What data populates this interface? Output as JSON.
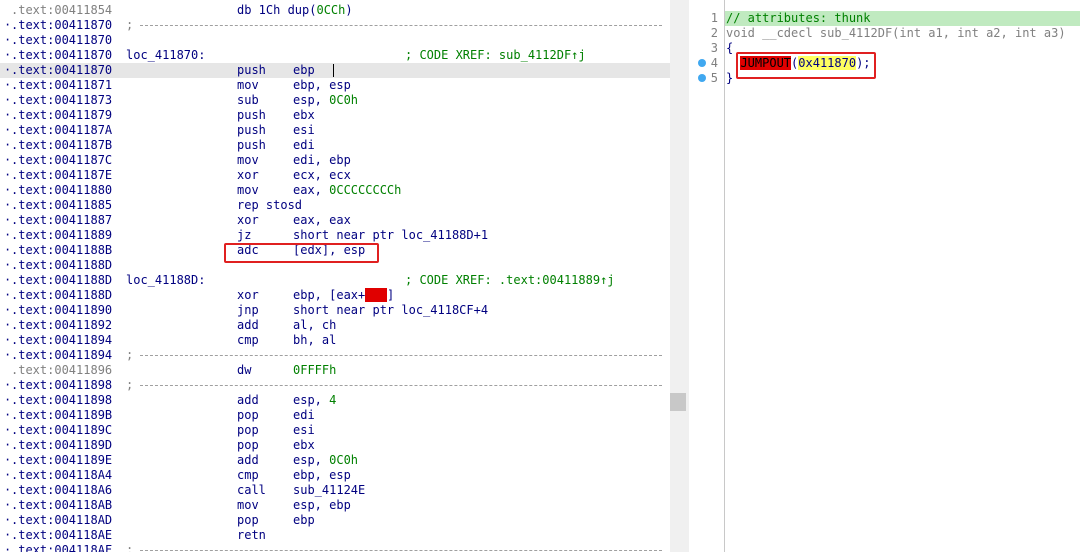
{
  "asm": {
    "rows": [
      {
        "addr": ".text:00411854",
        "mnem": "db 1Ch dup(",
        "num": "0CCh",
        "tail": ")"
      },
      {
        "addr": ".text:00411870",
        "sep": ";"
      },
      {
        "addr": ".text:00411870"
      },
      {
        "addr": ".text:00411870",
        "label": "loc_411870:",
        "xref": "; CODE XREF: sub_4112DF↑j"
      },
      {
        "addr": ".text:00411870",
        "mnem": "push",
        "ops": "ebp"
      },
      {
        "addr": ".text:00411871",
        "mnem": "mov",
        "ops": "ebp, esp"
      },
      {
        "addr": ".text:00411873",
        "mnem": "sub",
        "ops_pre": "esp, ",
        "ops_num": "0C0h"
      },
      {
        "addr": ".text:00411879",
        "mnem": "push",
        "ops": "ebx"
      },
      {
        "addr": ".text:0041187A",
        "mnem": "push",
        "ops": "esi"
      },
      {
        "addr": ".text:0041187B",
        "mnem": "push",
        "ops": "edi"
      },
      {
        "addr": ".text:0041187C",
        "mnem": "mov",
        "ops": "edi, ebp"
      },
      {
        "addr": ".text:0041187E",
        "mnem": "xor",
        "ops": "ecx, ecx"
      },
      {
        "addr": ".text:00411880",
        "mnem": "mov",
        "ops_pre": "eax, ",
        "ops_num": "0CCCCCCCCh"
      },
      {
        "addr": ".text:00411885",
        "mnem": "rep stosd"
      },
      {
        "addr": ".text:00411887",
        "mnem": "xor",
        "ops": "eax, eax"
      },
      {
        "addr": ".text:00411889",
        "mnem": "jz",
        "ops": "short near ptr loc_41188D+1"
      },
      {
        "addr": ".text:0041188B",
        "mnem": "adc",
        "ops": "[edx], esp"
      },
      {
        "addr": ".text:0041188D"
      },
      {
        "addr": ".text:0041188D",
        "label": "loc_41188D:",
        "xref": "; CODE XREF: .text:00411889↑j"
      },
      {
        "addr": ".text:0041188D",
        "mnem": "xor",
        "ops_pre": "ebp, [eax+",
        "ops_red": "30h",
        "ops_post": "]"
      },
      {
        "addr": ".text:00411890",
        "mnem": "jnp",
        "ops": "short near ptr loc_4118CF+4"
      },
      {
        "addr": ".text:00411892",
        "mnem": "add",
        "ops": "al, ch"
      },
      {
        "addr": ".text:00411894",
        "mnem": "cmp",
        "ops": "bh, al"
      },
      {
        "addr": ".text:00411894",
        "sep": ";"
      },
      {
        "addr": ".text:00411896",
        "mnem": "dw",
        "ops_num_only": "0FFFFh"
      },
      {
        "addr": ".text:00411898",
        "sep": ";"
      },
      {
        "addr": ".text:00411898",
        "mnem": "add",
        "ops_pre": "esp, ",
        "ops_num": "4"
      },
      {
        "addr": ".text:0041189B",
        "mnem": "pop",
        "ops": "edi"
      },
      {
        "addr": ".text:0041189C",
        "mnem": "pop",
        "ops": "esi"
      },
      {
        "addr": ".text:0041189D",
        "mnem": "pop",
        "ops": "ebx"
      },
      {
        "addr": ".text:0041189E",
        "mnem": "add",
        "ops_pre": "esp, ",
        "ops_num": "0C0h"
      },
      {
        "addr": ".text:004118A4",
        "mnem": "cmp",
        "ops": "ebp, esp"
      },
      {
        "addr": ".text:004118A6",
        "mnem": "call",
        "ops": "sub_41124E"
      },
      {
        "addr": ".text:004118AB",
        "mnem": "mov",
        "ops": "esp, ebp"
      },
      {
        "addr": ".text:004118AD",
        "mnem": "pop",
        "ops": "ebp"
      },
      {
        "addr": ".text:004118AE",
        "mnem": "retn"
      },
      {
        "addr": ".text:004118AF",
        "sep": ";"
      }
    ]
  },
  "pseudocode": {
    "lines": [
      {
        "num": "1",
        "text": "// attributes: thunk"
      },
      {
        "num": "2",
        "text": "void __cdecl sub_4112DF(int a1, int a2, int a3)"
      },
      {
        "num": "3",
        "text": "{"
      },
      {
        "num": "4",
        "pre": "  ",
        "call": "JUMPOUT",
        "paren_open": "(",
        "arg": "0x411870",
        "post": ");"
      },
      {
        "num": "5",
        "text": "}"
      }
    ]
  },
  "colors": {
    "highlight_red": "#e00000",
    "highlight_yellow": "#ffff60",
    "comment_green": "#008000",
    "box_red": "#e02020"
  }
}
